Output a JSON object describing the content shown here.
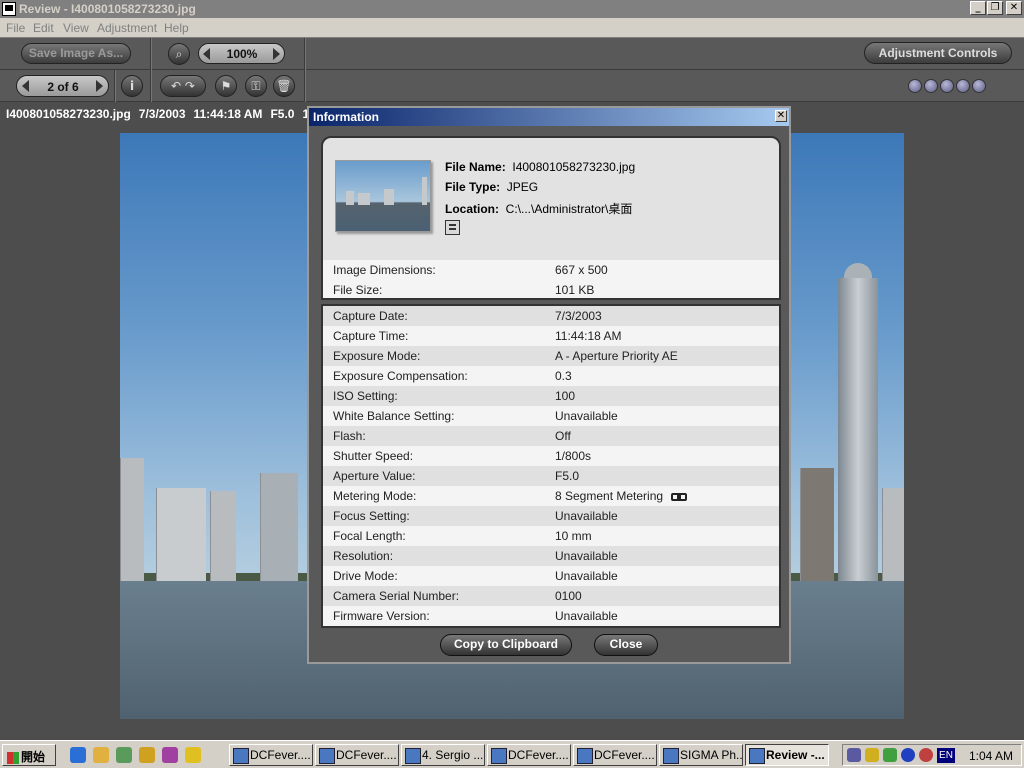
{
  "window": {
    "title": "Review - I400801058273230.jpg",
    "minimize": "_",
    "restore": "❐",
    "close": "✕"
  },
  "menu": [
    {
      "label": "File"
    },
    {
      "label": "Edit"
    },
    {
      "label": "View"
    },
    {
      "label": "Adjustment"
    },
    {
      "label": "Help"
    }
  ],
  "toolbar": {
    "save_image": "Save Image As...",
    "zoom_value": "100%",
    "adjustment_controls": "Adjustment Controls",
    "page_indicator": "2 of 6",
    "info_glyph": "i",
    "delete_glyph": "🗑"
  },
  "status_line": [
    "I400801058273230.jpg",
    "7/3/2003",
    "11:44:18 AM",
    "F5.0",
    "1."
  ],
  "info_dialog": {
    "title": "Information",
    "close_glyph": "✕",
    "file_name_label": "File Name:",
    "file_name": "I400801058273230.jpg",
    "file_type_label": "File Type:",
    "file_type": "JPEG",
    "location_label": "Location:",
    "location": "C:\\...\\Administrator\\桌面",
    "summary_rows": [
      {
        "key": "Image Dimensions:",
        "value": "667 x 500"
      },
      {
        "key": "File Size:",
        "value": "101 KB"
      }
    ],
    "detail_rows": [
      {
        "key": "Capture Date:",
        "value": "7/3/2003"
      },
      {
        "key": "Capture Time:",
        "value": "11:44:18 AM"
      },
      {
        "key": "Exposure Mode:",
        "value": "A - Aperture Priority AE"
      },
      {
        "key": "Exposure Compensation:",
        "value": "0.3"
      },
      {
        "key": "ISO Setting:",
        "value": "100"
      },
      {
        "key": "White Balance Setting:",
        "value": "Unavailable"
      },
      {
        "key": "Flash:",
        "value": "Off"
      },
      {
        "key": "Shutter Speed:",
        "value": "1/800s"
      },
      {
        "key": "Aperture Value:",
        "value": "F5.0"
      },
      {
        "key": "Metering Mode:",
        "value": "8 Segment Metering"
      },
      {
        "key": "Focus Setting:",
        "value": "Unavailable"
      },
      {
        "key": "Focal Length:",
        "value": "10 mm"
      },
      {
        "key": "Resolution:",
        "value": "Unavailable"
      },
      {
        "key": "Drive Mode:",
        "value": "Unavailable"
      },
      {
        "key": "Camera Serial Number:",
        "value": "0100"
      },
      {
        "key": "Firmware Version:",
        "value": "Unavailable"
      }
    ],
    "copy_button": "Copy to Clipboard",
    "close_button": "Close"
  },
  "taskbar": {
    "start_label": "開始",
    "tasks": [
      {
        "label": "DCFever...."
      },
      {
        "label": "DCFever...."
      },
      {
        "label": "4. Sergio ..."
      },
      {
        "label": "DCFever...."
      },
      {
        "label": "DCFever...."
      },
      {
        "label": "SIGMA Ph..."
      },
      {
        "label": "Review -..."
      }
    ],
    "lang": "EN",
    "clock": "1:04 AM"
  },
  "colors": {
    "app_bg": "#4d4d4d",
    "toolbar_bg": "#595959",
    "dialog_title_start": "#0a246a",
    "dialog_title_end": "#a6caf0"
  }
}
